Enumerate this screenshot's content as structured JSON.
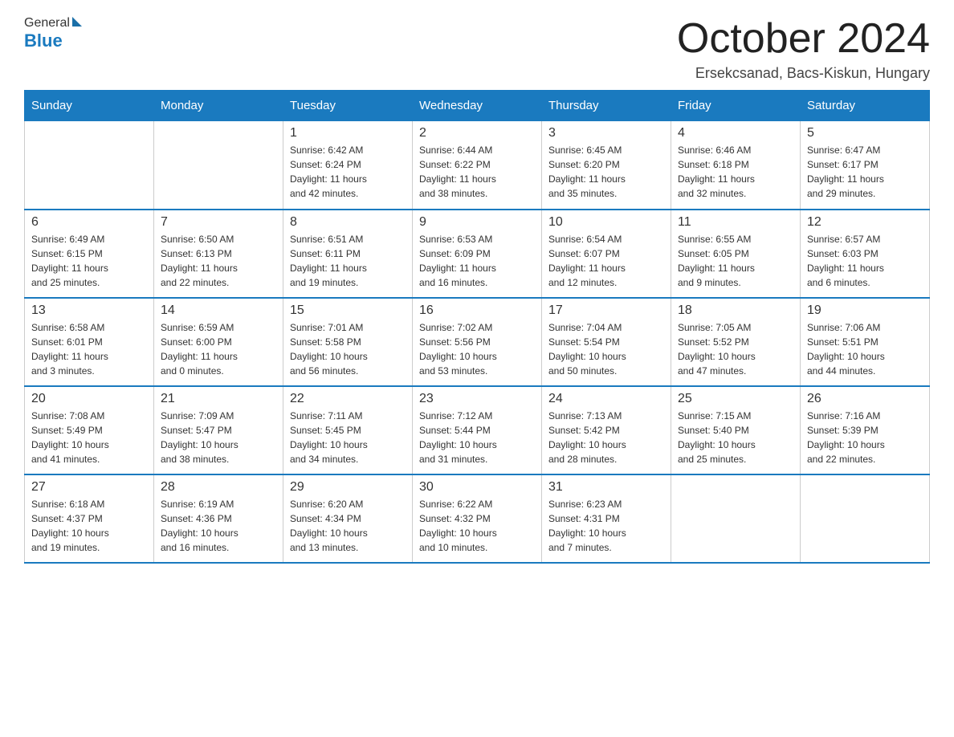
{
  "header": {
    "logo_general": "General",
    "logo_blue": "Blue",
    "month_title": "October 2024",
    "location": "Ersekcsanad, Bacs-Kiskun, Hungary"
  },
  "days_of_week": [
    "Sunday",
    "Monday",
    "Tuesday",
    "Wednesday",
    "Thursday",
    "Friday",
    "Saturday"
  ],
  "weeks": [
    [
      {
        "day": "",
        "info": ""
      },
      {
        "day": "",
        "info": ""
      },
      {
        "day": "1",
        "info": "Sunrise: 6:42 AM\nSunset: 6:24 PM\nDaylight: 11 hours\nand 42 minutes."
      },
      {
        "day": "2",
        "info": "Sunrise: 6:44 AM\nSunset: 6:22 PM\nDaylight: 11 hours\nand 38 minutes."
      },
      {
        "day": "3",
        "info": "Sunrise: 6:45 AM\nSunset: 6:20 PM\nDaylight: 11 hours\nand 35 minutes."
      },
      {
        "day": "4",
        "info": "Sunrise: 6:46 AM\nSunset: 6:18 PM\nDaylight: 11 hours\nand 32 minutes."
      },
      {
        "day": "5",
        "info": "Sunrise: 6:47 AM\nSunset: 6:17 PM\nDaylight: 11 hours\nand 29 minutes."
      }
    ],
    [
      {
        "day": "6",
        "info": "Sunrise: 6:49 AM\nSunset: 6:15 PM\nDaylight: 11 hours\nand 25 minutes."
      },
      {
        "day": "7",
        "info": "Sunrise: 6:50 AM\nSunset: 6:13 PM\nDaylight: 11 hours\nand 22 minutes."
      },
      {
        "day": "8",
        "info": "Sunrise: 6:51 AM\nSunset: 6:11 PM\nDaylight: 11 hours\nand 19 minutes."
      },
      {
        "day": "9",
        "info": "Sunrise: 6:53 AM\nSunset: 6:09 PM\nDaylight: 11 hours\nand 16 minutes."
      },
      {
        "day": "10",
        "info": "Sunrise: 6:54 AM\nSunset: 6:07 PM\nDaylight: 11 hours\nand 12 minutes."
      },
      {
        "day": "11",
        "info": "Sunrise: 6:55 AM\nSunset: 6:05 PM\nDaylight: 11 hours\nand 9 minutes."
      },
      {
        "day": "12",
        "info": "Sunrise: 6:57 AM\nSunset: 6:03 PM\nDaylight: 11 hours\nand 6 minutes."
      }
    ],
    [
      {
        "day": "13",
        "info": "Sunrise: 6:58 AM\nSunset: 6:01 PM\nDaylight: 11 hours\nand 3 minutes."
      },
      {
        "day": "14",
        "info": "Sunrise: 6:59 AM\nSunset: 6:00 PM\nDaylight: 11 hours\nand 0 minutes."
      },
      {
        "day": "15",
        "info": "Sunrise: 7:01 AM\nSunset: 5:58 PM\nDaylight: 10 hours\nand 56 minutes."
      },
      {
        "day": "16",
        "info": "Sunrise: 7:02 AM\nSunset: 5:56 PM\nDaylight: 10 hours\nand 53 minutes."
      },
      {
        "day": "17",
        "info": "Sunrise: 7:04 AM\nSunset: 5:54 PM\nDaylight: 10 hours\nand 50 minutes."
      },
      {
        "day": "18",
        "info": "Sunrise: 7:05 AM\nSunset: 5:52 PM\nDaylight: 10 hours\nand 47 minutes."
      },
      {
        "day": "19",
        "info": "Sunrise: 7:06 AM\nSunset: 5:51 PM\nDaylight: 10 hours\nand 44 minutes."
      }
    ],
    [
      {
        "day": "20",
        "info": "Sunrise: 7:08 AM\nSunset: 5:49 PM\nDaylight: 10 hours\nand 41 minutes."
      },
      {
        "day": "21",
        "info": "Sunrise: 7:09 AM\nSunset: 5:47 PM\nDaylight: 10 hours\nand 38 minutes."
      },
      {
        "day": "22",
        "info": "Sunrise: 7:11 AM\nSunset: 5:45 PM\nDaylight: 10 hours\nand 34 minutes."
      },
      {
        "day": "23",
        "info": "Sunrise: 7:12 AM\nSunset: 5:44 PM\nDaylight: 10 hours\nand 31 minutes."
      },
      {
        "day": "24",
        "info": "Sunrise: 7:13 AM\nSunset: 5:42 PM\nDaylight: 10 hours\nand 28 minutes."
      },
      {
        "day": "25",
        "info": "Sunrise: 7:15 AM\nSunset: 5:40 PM\nDaylight: 10 hours\nand 25 minutes."
      },
      {
        "day": "26",
        "info": "Sunrise: 7:16 AM\nSunset: 5:39 PM\nDaylight: 10 hours\nand 22 minutes."
      }
    ],
    [
      {
        "day": "27",
        "info": "Sunrise: 6:18 AM\nSunset: 4:37 PM\nDaylight: 10 hours\nand 19 minutes."
      },
      {
        "day": "28",
        "info": "Sunrise: 6:19 AM\nSunset: 4:36 PM\nDaylight: 10 hours\nand 16 minutes."
      },
      {
        "day": "29",
        "info": "Sunrise: 6:20 AM\nSunset: 4:34 PM\nDaylight: 10 hours\nand 13 minutes."
      },
      {
        "day": "30",
        "info": "Sunrise: 6:22 AM\nSunset: 4:32 PM\nDaylight: 10 hours\nand 10 minutes."
      },
      {
        "day": "31",
        "info": "Sunrise: 6:23 AM\nSunset: 4:31 PM\nDaylight: 10 hours\nand 7 minutes."
      },
      {
        "day": "",
        "info": ""
      },
      {
        "day": "",
        "info": ""
      }
    ]
  ]
}
